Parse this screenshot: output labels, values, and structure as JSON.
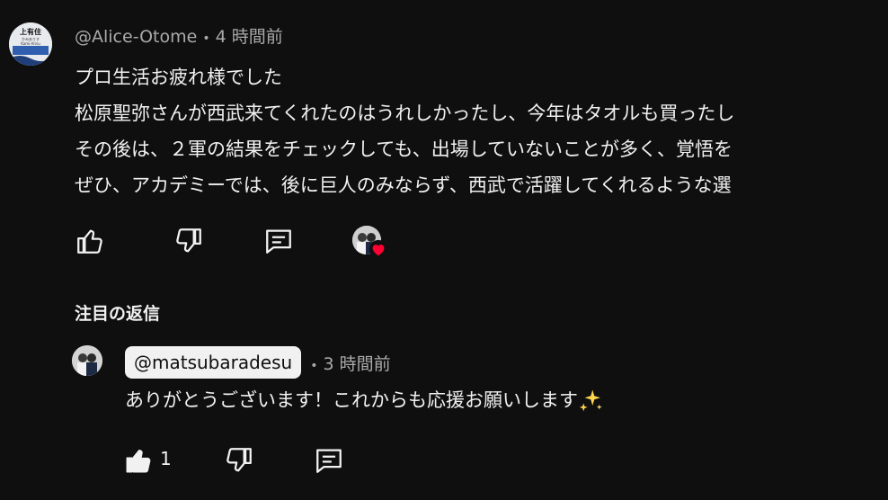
{
  "comment": {
    "author": "@Alice-Otome",
    "time": "4 時間前",
    "lines": [
      "プロ生活お疲れ様でした",
      "松原聖弥さんが西武来てくれたのはうれしかったし、今年はタオルも買ったし",
      "その後は、２軍の結果をチェックしても、出場していないことが多く、覚悟を",
      "ぜひ、アカデミーでは、後に巨人のみならず、西武で活躍してくれるような選"
    ],
    "avatar_text": {
      "top": "上有住",
      "small": "かみありす",
      "latin": "Kami-Arisu"
    },
    "icons": [
      "thumbs-up-icon",
      "thumbs-down-icon",
      "reply-icon",
      "creator-heart-icon"
    ]
  },
  "pinned": {
    "title": "注目の返信"
  },
  "reply": {
    "author": "@matsubaradesu",
    "time": "3 時間前",
    "text": "ありがとうございます！これからも応援お願いします",
    "like_count": "1",
    "icons": [
      "thumbs-up-filled-icon",
      "thumbs-down-icon",
      "reply-icon",
      "sparkles-icon"
    ]
  },
  "colors": {
    "background": "#0f0f0f",
    "text": "#f1f1f1",
    "secondary": "#aaaaaa",
    "heart": "#ff0033",
    "sparkle": "#ffd54f"
  }
}
